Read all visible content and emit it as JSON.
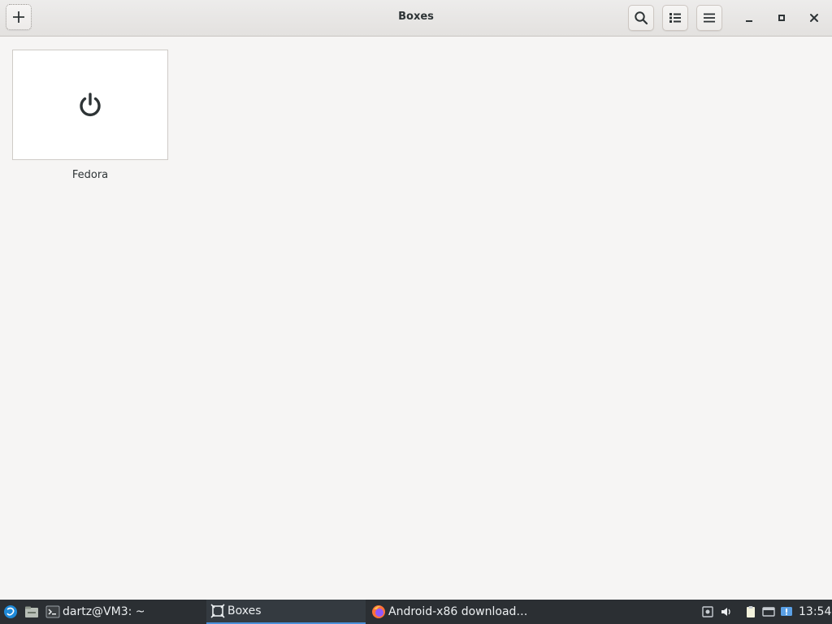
{
  "window": {
    "title": "Boxes"
  },
  "header": {
    "new_icon": "plus-icon",
    "search_icon": "search-icon",
    "view_icon": "list-view-icon",
    "menu_icon": "hamburger-menu-icon",
    "minimize_icon": "minimize-icon",
    "maximize_icon": "maximize-icon",
    "close_icon": "close-icon"
  },
  "machines": [
    {
      "name": "Fedora",
      "state_icon": "power-icon"
    }
  ],
  "taskbar": {
    "start_icon": "whisker-menu-icon",
    "files_icon": "file-manager-icon",
    "tasks": [
      {
        "label": "dartz@VM3: ~",
        "icon": "terminal-icon",
        "active": false
      },
      {
        "label": "Boxes",
        "icon": "boxes-icon",
        "active": true
      },
      {
        "label": "Android-x86 download…",
        "icon": "firefox-icon",
        "active": false
      }
    ],
    "tray": [
      "screenshot-icon",
      "volume-icon",
      "clipboard-icon",
      "display-icon",
      "notification-icon"
    ],
    "clock": "13:54"
  },
  "colors": {
    "background": "#f6f5f4",
    "taskbar": "#2b2f33",
    "active_task_underline": "#4a90d9"
  }
}
